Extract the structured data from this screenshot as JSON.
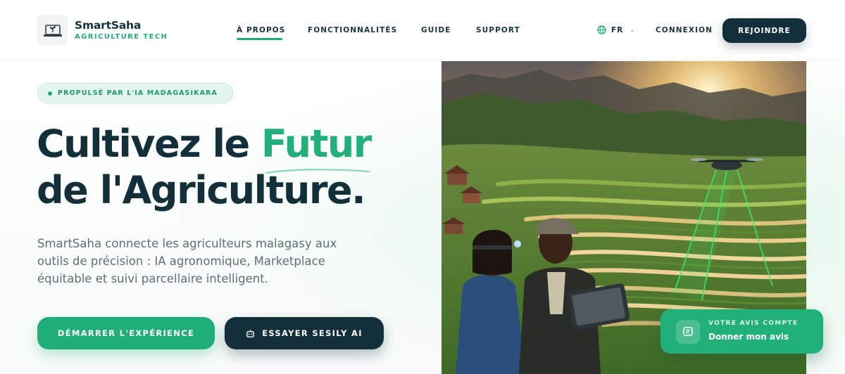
{
  "brand": {
    "name": "SmartSaha",
    "tagline": "AGRICULTURE TECH",
    "logo_icon": "laptop-plant-icon"
  },
  "nav": {
    "items": [
      {
        "label": "À PROPOS",
        "active": true
      },
      {
        "label": "FONCTIONNALITÉS",
        "active": false
      },
      {
        "label": "GUIDE",
        "active": false
      },
      {
        "label": "SUPPORT",
        "active": false
      }
    ],
    "language": {
      "label": "FR",
      "icon": "globe-icon"
    },
    "login_label": "CONNEXION",
    "join_label": "REJOINDRE"
  },
  "hero": {
    "badge": "PROPULSÉ PAR L'IA MADAGASIKARA",
    "headline_part1": "Cultivez le ",
    "headline_accent": "Futur",
    "headline_line2": "de l'Agriculture.",
    "lead": "SmartSaha connecte les agriculteurs malagasy aux outils de précision : IA agronomique, Marketplace équitable et suivi parcellaire intelligent.",
    "cta_primary": "DÉMARRER L'EXPÉRIENCE",
    "cta_secondary": "ESSAYER SESILY AI",
    "cta_secondary_icon": "robot-icon"
  },
  "feedback": {
    "kicker": "VOTRE AVIS COMPTE",
    "label": "Donner mon avis",
    "icon": "message-icon"
  },
  "colors": {
    "brand_green": "#1fae78",
    "dark_navy": "#13303a",
    "text_muted": "#5d6f74"
  }
}
